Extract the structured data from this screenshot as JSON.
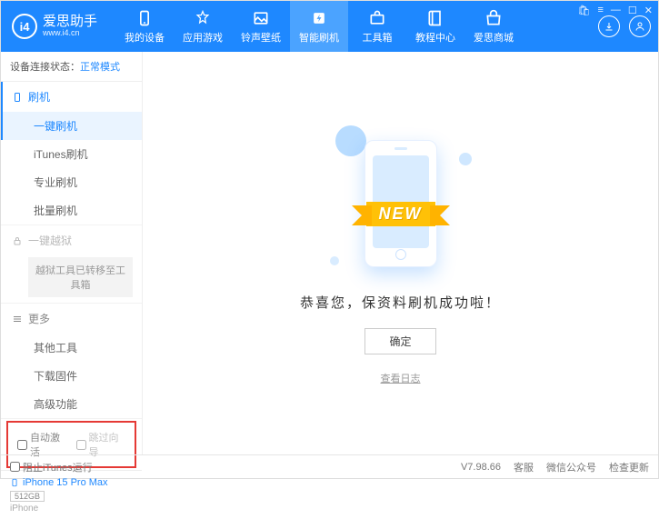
{
  "header": {
    "logo_title": "爱思助手",
    "logo_sub": "www.i4.cn",
    "nav": [
      {
        "label": "我的设备"
      },
      {
        "label": "应用游戏"
      },
      {
        "label": "铃声壁纸"
      },
      {
        "label": "智能刷机"
      },
      {
        "label": "工具箱"
      },
      {
        "label": "教程中心"
      },
      {
        "label": "爱思商城"
      }
    ]
  },
  "sidebar": {
    "status_label": "设备连接状态：",
    "status_value": "正常模式",
    "sections": {
      "flash": {
        "title": "刷机",
        "items": [
          "一键刷机",
          "iTunes刷机",
          "专业刷机",
          "批量刷机"
        ]
      },
      "jailbreak": {
        "title": "一键越狱",
        "moved_notice": "越狱工具已转移至工具箱"
      },
      "more": {
        "title": "更多",
        "items": [
          "其他工具",
          "下载固件",
          "高级功能"
        ]
      }
    },
    "checkboxes": {
      "auto_activate": "自动激活",
      "skip_guide": "跳过向导"
    },
    "device": {
      "name": "iPhone 15 Pro Max",
      "storage": "512GB",
      "type": "iPhone"
    }
  },
  "main": {
    "ribbon": "NEW",
    "success": "恭喜您，保资料刷机成功啦！",
    "ok": "确定",
    "log": "查看日志"
  },
  "footer": {
    "block_itunes": "阻止iTunes运行",
    "version": "V7.98.66",
    "links": [
      "客服",
      "微信公众号",
      "检查更新"
    ]
  }
}
